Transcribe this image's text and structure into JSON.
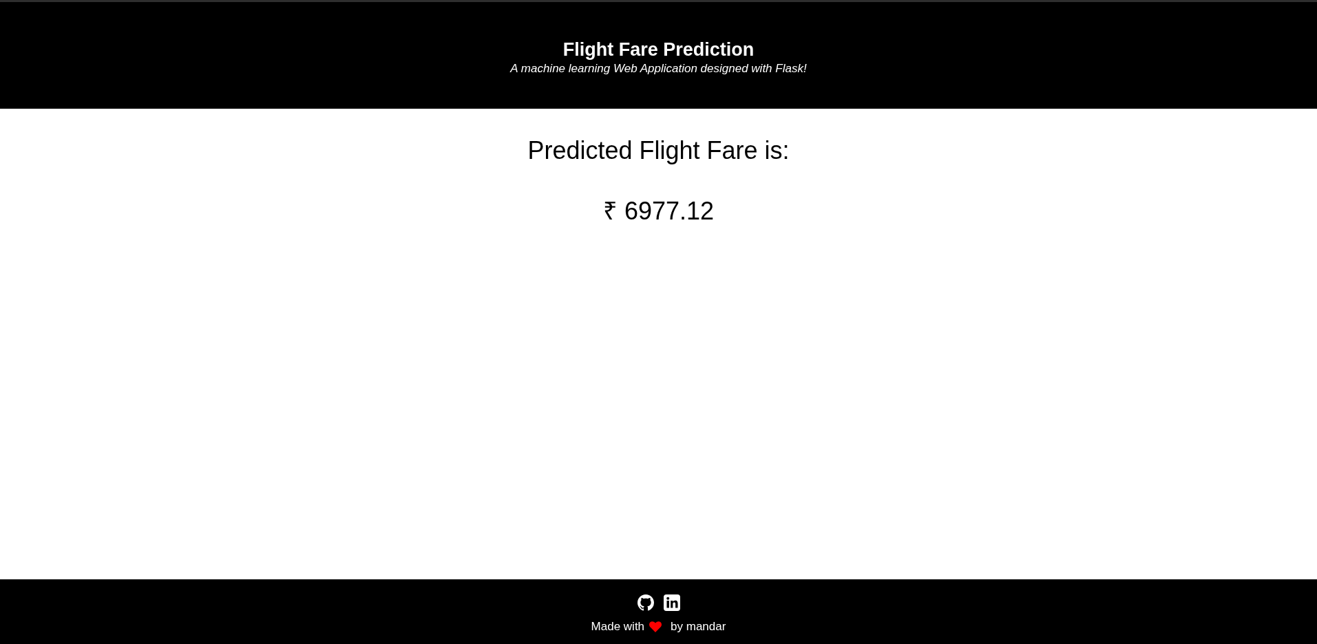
{
  "header": {
    "title": "Flight Fare Prediction",
    "subtitle": "A machine learning Web Application designed with Flask!"
  },
  "result": {
    "label": "Predicted Flight Fare is:",
    "value": "₹ 6977.12"
  },
  "footer": {
    "made_with": "Made with",
    "author": "by mandar"
  }
}
